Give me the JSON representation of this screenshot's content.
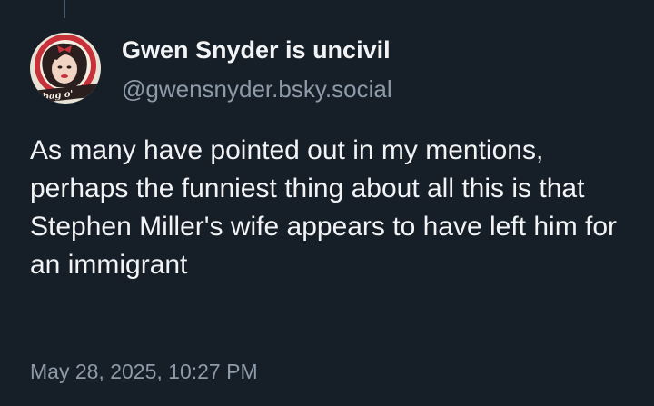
{
  "post": {
    "display_name": "Gwen Snyder is uncivil",
    "handle": "@gwensnyder.bsky.social",
    "avatar_icon": "avatar-pinup-illustration",
    "avatar_caption": "bag o'",
    "text": "As many have pointed out in my mentions, perhaps the funniest thing about all this is that Stephen Miller's wife appears to have left him for an immigrant",
    "timestamp": "May 28, 2025, 10:27 PM"
  },
  "colors": {
    "background": "#161e27",
    "primary_text": "#f1f3f5",
    "secondary_text": "#8d9aa8",
    "thread_line": "#4a5968"
  }
}
